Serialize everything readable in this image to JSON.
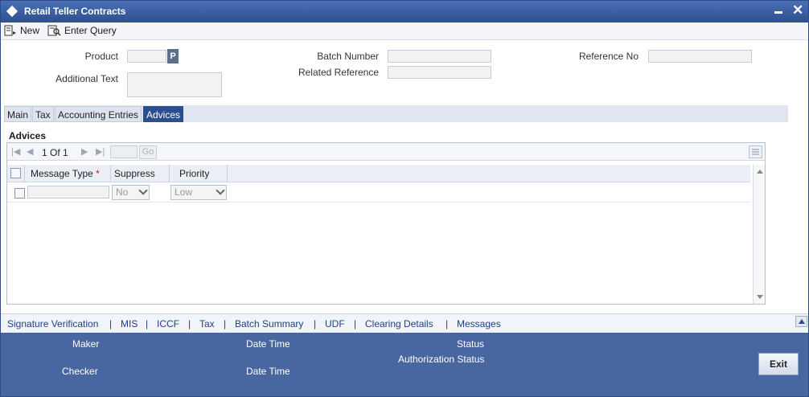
{
  "window": {
    "title": "Retail Teller Contracts"
  },
  "toolbar": {
    "new_label": "New",
    "enter_query_label": "Enter Query"
  },
  "form": {
    "product_label": "Product",
    "product_lov_label": "P",
    "additional_text_label": "Additional Text",
    "batch_number_label": "Batch Number",
    "related_reference_label": "Related Reference",
    "reference_no_label": "Reference No"
  },
  "tabs": [
    {
      "label": "Main"
    },
    {
      "label": "Tax"
    },
    {
      "label": "Accounting Entries"
    },
    {
      "label": "Advices"
    }
  ],
  "advices": {
    "section_title": "Advices",
    "pager_text": "1 Of 1",
    "go_label": "Go",
    "columns": {
      "message_type": "Message Type",
      "required_mark": "*",
      "suppress": "Suppress",
      "priority": "Priority"
    },
    "row": {
      "suppress_value": "No",
      "priority_value": "Low"
    }
  },
  "links": [
    "Signature Verification",
    "MIS",
    "ICCF",
    "Tax",
    "Batch Summary",
    "UDF",
    "Clearing Details",
    "Messages"
  ],
  "link_separator": "|",
  "footer": {
    "maker_label": "Maker",
    "checker_label": "Checker",
    "date_time_label": "Date Time",
    "date_time_label_2": "Date Time",
    "status_label": "Status",
    "authorization_status_label": "Authorization Status",
    "exit_label": "Exit"
  },
  "colors": {
    "titlebar": "#2e508f",
    "active_tab": "#2b4e8e",
    "footer": "#48669f",
    "link": "#1f3f8a"
  }
}
